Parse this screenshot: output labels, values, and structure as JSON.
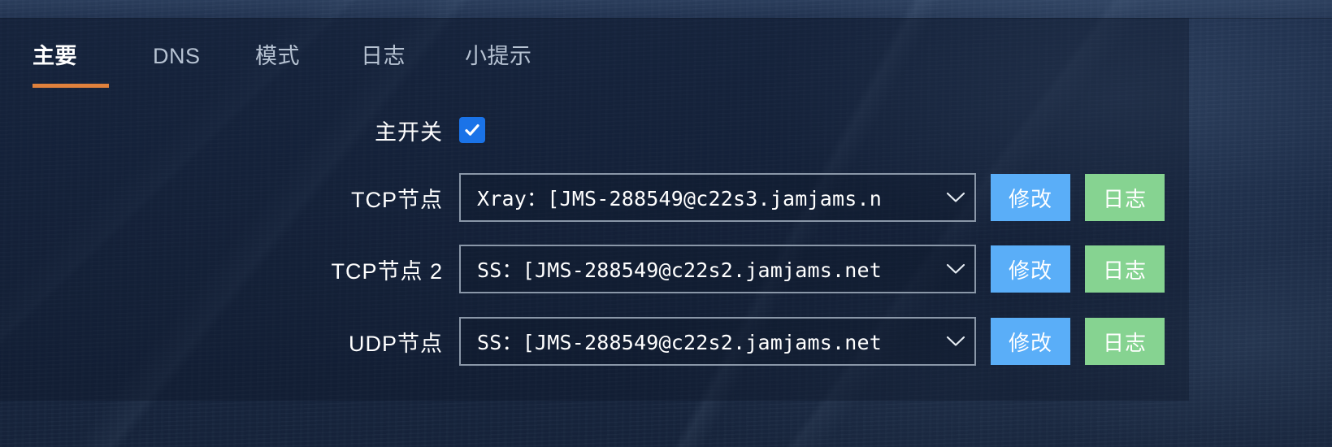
{
  "window": {
    "accent_orange": "#e0813c",
    "checkbox_blue": "#1a73e8",
    "edit_button_color": "#5aaef8",
    "log_button_color": "#86d391"
  },
  "tabs": [
    {
      "label": "主要",
      "active": true
    },
    {
      "label": "DNS",
      "active": false
    },
    {
      "label": "模式",
      "active": false
    },
    {
      "label": "日志",
      "active": false
    },
    {
      "label": "小提示",
      "active": false
    }
  ],
  "form": {
    "master_switch": {
      "label": "主开关",
      "checked": true
    },
    "rows": [
      {
        "label": "TCP节点",
        "value": "Xray：[JMS-288549@c22s3.jamjams.n",
        "edit_label": "修改",
        "log_label": "日志"
      },
      {
        "label": "TCP节点 2",
        "value": "SS：[JMS-288549@c22s2.jamjams.net",
        "edit_label": "修改",
        "log_label": "日志"
      },
      {
        "label": "UDP节点",
        "value": "SS：[JMS-288549@c22s2.jamjams.net",
        "edit_label": "修改",
        "log_label": "日志"
      }
    ]
  }
}
